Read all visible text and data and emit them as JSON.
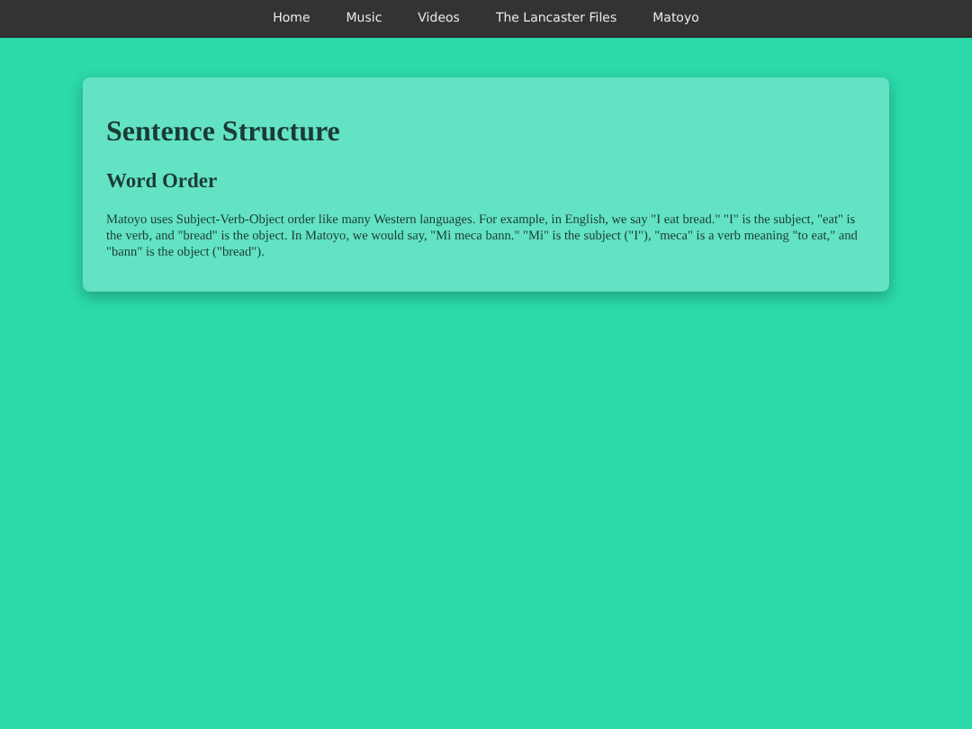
{
  "nav": {
    "items": [
      "Home",
      "Music",
      "Videos",
      "The Lancaster Files",
      "Matoyo"
    ]
  },
  "card": {
    "title": "Sentence Structure",
    "heading": "Word Order",
    "paragraph": "Matoyo uses Subject-Verb-Object order like many Western languages. For example, in English, we say \"I eat bread.\" \"I\" is the subject, \"eat\" is the verb, and \"bread\" is the object. In Matoyo, we would say, \"Mi meca bann.\" \"Mi\" is the subject (\"I\"), \"meca\" is a verb meaning \"to eat,\" and \"bann\" is the object (\"bread\")."
  }
}
